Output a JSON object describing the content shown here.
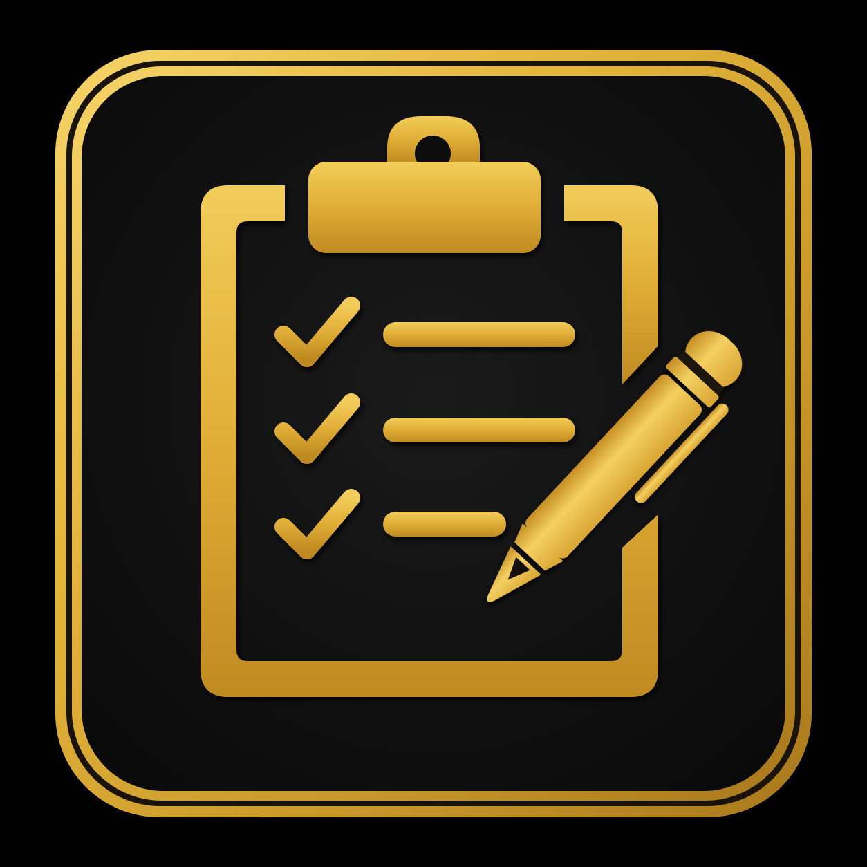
{
  "app_icon": {
    "icon_name": "clipboard-checklist-pen-icon",
    "checklist": {
      "items": [
        {
          "checked": true,
          "line": "long"
        },
        {
          "checked": true,
          "line": "long"
        },
        {
          "checked": true,
          "line": "short"
        }
      ]
    },
    "colors": {
      "background": "#000000",
      "tile_fill": "#121212",
      "gold_light": "#F6D46A",
      "gold_mid": "#E2B43A",
      "gold_dark": "#A8781C",
      "gold_shadow": "#6E4A0E"
    }
  }
}
